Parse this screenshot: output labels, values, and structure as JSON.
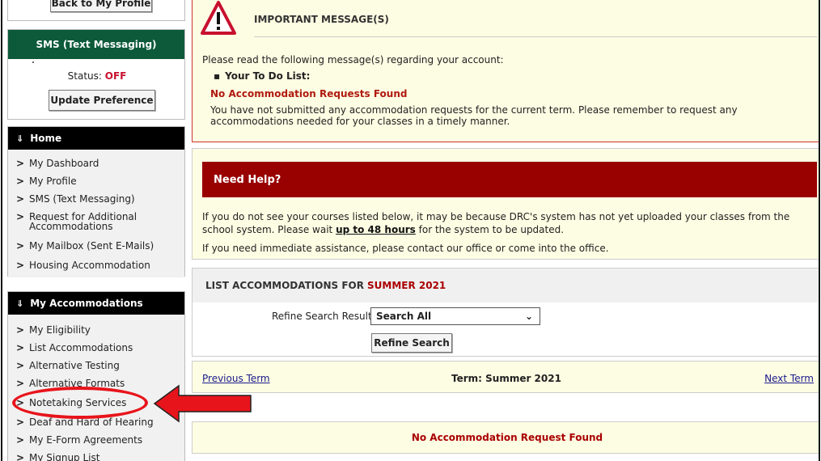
{
  "sidebar": {
    "back_button": "Back to My Profile",
    "sms": {
      "title": "SMS (Text Messaging)",
      "status_label": "Status:",
      "status_value": "OFF",
      "update_button": "Update Preference"
    },
    "home": {
      "title": "Home",
      "items": [
        "My Dashboard",
        "My Profile",
        "SMS (Text Messaging)",
        "Request for Additional Accommodations",
        "My Mailbox (Sent E-Mails)",
        "Housing Accommodation"
      ]
    },
    "accommodations": {
      "title": "My Accommodations",
      "items": [
        "My Eligibility",
        "List Accommodations",
        "Alternative Testing",
        "Alternative Formats",
        "Notetaking Services",
        "Deaf and Hard of Hearing",
        "My E-Form Agreements",
        "My Signup List"
      ]
    }
  },
  "message": {
    "title": "IMPORTANT MESSAGE(S)",
    "intro": "Please read the following message(s) regarding your account:",
    "todo_label": "Your To Do List",
    "todo_title": "No Accommodation Requests Found",
    "todo_body": "You have not submitted any accommodation requests for the current term. Please remember to request any accommodations needed for your classes in a timely manner."
  },
  "help": {
    "title": "Need Help?",
    "body_prefix": "If you do not see your courses listed below, it may be because DRC's system has not yet uploaded your classes from the school system. Please wait ",
    "body_link": "up to 48 hours",
    "body_suffix": " for the system to be updated.",
    "body2": "If you need immediate assistance, please contact our office or come into the office."
  },
  "list": {
    "title": "LIST ACCOMMODATIONS FOR",
    "term": "SUMMER 2021",
    "refine_label": "Refine Search Result:",
    "refine_selected": "Search All",
    "refine_button": "Refine Search"
  },
  "term_nav": {
    "prev": "Previous Term",
    "current": "Term: Summer 2021",
    "next": "Next Term"
  },
  "no_results": "No Accommodation Request Found",
  "colors": {
    "sms_header": "#0c5a3a",
    "help_header": "#990000",
    "annotation": "#e8141b",
    "panel_bg": "#fdfde3"
  }
}
